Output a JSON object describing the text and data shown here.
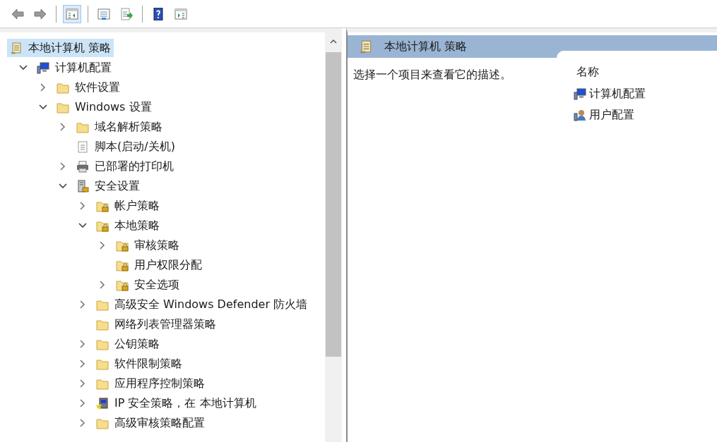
{
  "toolbar": [
    {
      "kind": "back",
      "pressed": false
    },
    {
      "kind": "forward",
      "pressed": false
    },
    {
      "kind": "separator"
    },
    {
      "kind": "tree",
      "pressed": true
    },
    {
      "kind": "separator"
    },
    {
      "kind": "properties",
      "pressed": false
    },
    {
      "kind": "export",
      "pressed": false
    },
    {
      "kind": "separator"
    },
    {
      "kind": "help",
      "pressed": false
    },
    {
      "kind": "actions",
      "pressed": false
    }
  ],
  "tree": {
    "label": "本地计算机 策略",
    "kind": "policy",
    "selected": true,
    "children": [
      {
        "label": "计算机配置",
        "kind": "computer",
        "selected": false,
        "expandable": true,
        "expanded": true,
        "children": [
          {
            "label": "软件设置",
            "kind": "folder",
            "selected": false,
            "expandable": true,
            "expanded": false
          },
          {
            "label": "Windows 设置",
            "kind": "folder",
            "selected": false,
            "expandable": true,
            "expanded": true,
            "children": [
              {
                "label": "域名解析策略",
                "kind": "folder",
                "selected": false,
                "expandable": true,
                "expanded": false
              },
              {
                "label": "脚本(启动/关机)",
                "kind": "script",
                "selected": false,
                "expandable": false
              },
              {
                "label": "已部署的打印机",
                "kind": "printer",
                "selected": false,
                "expandable": true,
                "expanded": false
              },
              {
                "label": "安全设置",
                "kind": "server",
                "selected": false,
                "expandable": true,
                "expanded": true,
                "children": [
                  {
                    "label": "帐户策略",
                    "kind": "lockfolder",
                    "selected": false,
                    "expandable": true,
                    "expanded": false
                  },
                  {
                    "label": "本地策略",
                    "kind": "lockfolder",
                    "selected": false,
                    "expandable": true,
                    "expanded": true,
                    "children": [
                      {
                        "label": "审核策略",
                        "kind": "lockfolder",
                        "selected": false,
                        "expandable": true,
                        "expanded": false
                      },
                      {
                        "label": "用户权限分配",
                        "kind": "lockfolder",
                        "selected": false,
                        "expandable": false
                      },
                      {
                        "label": "安全选项",
                        "kind": "lockfolder",
                        "selected": false,
                        "expandable": true,
                        "expanded": false
                      }
                    ]
                  },
                  {
                    "label": "高级安全 Windows Defender 防火墙",
                    "kind": "folder",
                    "selected": false,
                    "expandable": true,
                    "expanded": false
                  },
                  {
                    "label": "网络列表管理器策略",
                    "kind": "folder",
                    "selected": false,
                    "expandable": false
                  },
                  {
                    "label": "公钥策略",
                    "kind": "folder",
                    "selected": false,
                    "expandable": true,
                    "expanded": false
                  },
                  {
                    "label": "软件限制策略",
                    "kind": "folder",
                    "selected": false,
                    "expandable": true,
                    "expanded": false
                  },
                  {
                    "label": "应用程序控制策略",
                    "kind": "folder",
                    "selected": false,
                    "expandable": true,
                    "expanded": false
                  },
                  {
                    "label": "IP 安全策略，在 本地计算机",
                    "kind": "ipsec",
                    "selected": false,
                    "expandable": true,
                    "expanded": false
                  },
                  {
                    "label": "高级审核策略配置",
                    "kind": "folder",
                    "selected": false,
                    "expandable": true,
                    "expanded": false
                  }
                ]
              }
            ]
          }
        ]
      }
    ]
  },
  "result_pane": {
    "title": "本地计算机 策略",
    "description": "选择一个项目来查看它的描述。",
    "column": "名称",
    "items": [
      {
        "label": "计算机配置",
        "kind": "computer"
      },
      {
        "label": "用户配置",
        "kind": "user"
      }
    ]
  }
}
